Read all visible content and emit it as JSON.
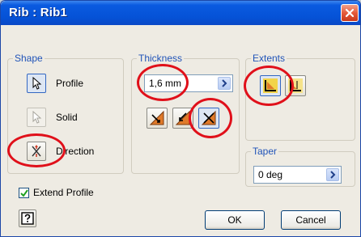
{
  "window": {
    "title": "Rib : Rib1",
    "close_icon": "close-icon"
  },
  "shape": {
    "label": "Shape",
    "profile_label": "Profile",
    "solid_label": "Solid",
    "direction_label": "Direction"
  },
  "thickness": {
    "label": "Thickness",
    "value": "1,6 mm"
  },
  "extents": {
    "label": "Extents"
  },
  "taper": {
    "label": "Taper",
    "value": "0 deg"
  },
  "extend_profile": {
    "label": "Extend Profile",
    "checked": true
  },
  "buttons": {
    "ok": "OK",
    "cancel": "Cancel"
  },
  "colors": {
    "annotation": "#e0101a",
    "title_bar": "#0552d6",
    "group_label": "#2154b8"
  }
}
